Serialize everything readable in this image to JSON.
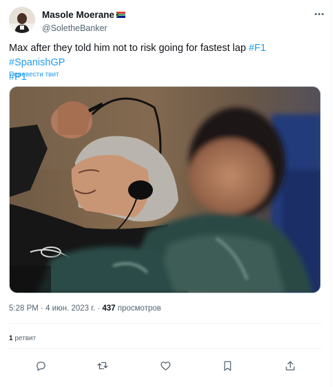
{
  "author": {
    "display_name": "Masole Moerane",
    "handle": "@SoletheBanker"
  },
  "tweet": {
    "text": "Max after they told him not to risk going for fastest lap ",
    "hashtags": [
      "#F1",
      "#SpanishGP",
      "#P1"
    ],
    "translate_label": "Перевести твит"
  },
  "meta": {
    "time": "5:28 PM",
    "separator": "·",
    "date": "4 июн. 2023 г.",
    "views_count": "437",
    "views_label": "просмотров"
  },
  "stats": {
    "retweet_count": "1",
    "retweet_label": "ретвит"
  },
  "icons": {
    "reply": "reply-icon",
    "retweet": "retweet-icon",
    "like": "heart-icon",
    "bookmark": "bookmark-icon",
    "share": "share-icon",
    "more": "more-icon"
  },
  "colors": {
    "link": "#1d9bf0",
    "text": "#0f1419",
    "secondary": "#536471"
  }
}
